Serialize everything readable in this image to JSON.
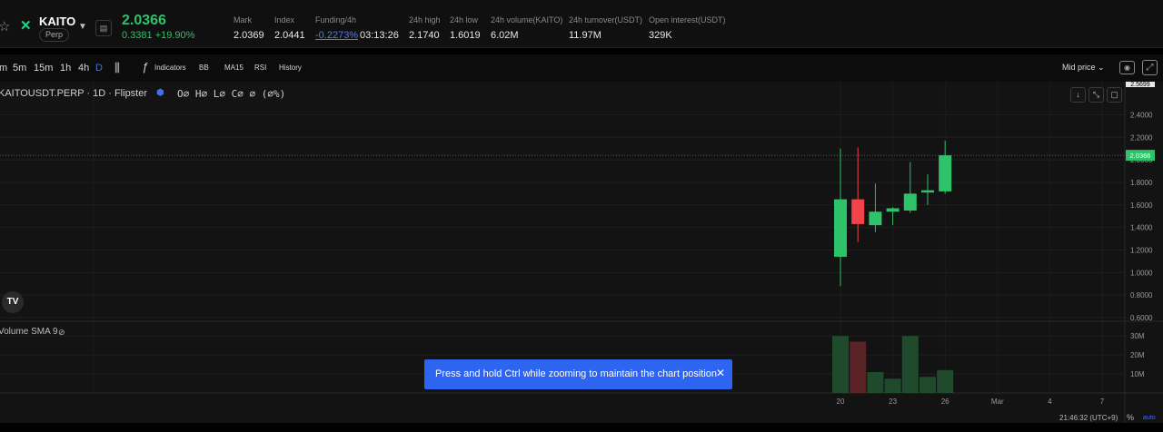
{
  "ticker": {
    "symbol": "KAITO",
    "contract_type": "Perp",
    "last_price": "2.0366",
    "change": "0.3381 +19.90%",
    "price_color": "#2ec26a"
  },
  "stats": [
    {
      "label": "Mark",
      "value": "2.0369"
    },
    {
      "label": "Index",
      "value": "2.0441"
    },
    {
      "label": "Funding/4h",
      "value": "-0.2273%",
      "extra": "03:13:26"
    },
    {
      "label": "24h high",
      "value": "2.1740"
    },
    {
      "label": "24h low",
      "value": "1.6019"
    },
    {
      "label": "24h volume(KAITO)",
      "value": "6.02M"
    },
    {
      "label": "24h turnover(USDT)",
      "value": "11.97M"
    },
    {
      "label": "Open interest(USDT)",
      "value": "329K"
    }
  ],
  "toolbar": {
    "timeframes": [
      "m",
      "5m",
      "15m",
      "1h",
      "4h",
      "D"
    ],
    "active_timeframe": "D",
    "indicators_label": "Indicators",
    "bb_label": "BB",
    "ma_label": "MA15",
    "rsi_label": "RSI",
    "history_label": "History",
    "price_source": "Mid price",
    "icons": [
      "candle-type-icon",
      "fx-icon",
      "camera-icon",
      "expand-icon"
    ]
  },
  "chart": {
    "title": "KAITOUSDT.PERP · 1D · Flipster",
    "ohlc_text": "O∅ H∅ L∅ C∅ ∅ (∅%)",
    "volume_label": "Volume SMA 9",
    "current_price_tag": "2.0366",
    "top_tag": "2.5699",
    "up_color": "#2ec26a",
    "down_color": "#f2424b"
  },
  "chart_data": {
    "type": "candlestick",
    "x_ticks": [
      "20",
      "23",
      "26",
      "Mar",
      "4",
      "7"
    ],
    "y_ticks": [
      "2.4000",
      "2.2000",
      "2.0000",
      "1.8000",
      "1.6000",
      "1.4000",
      "1.2000",
      "1.0000",
      "0.8000",
      "0.6000"
    ],
    "ylim": [
      0.6,
      2.5
    ],
    "candles": [
      {
        "o": 1.14,
        "h": 2.1,
        "l": 0.88,
        "c": 1.65
      },
      {
        "o": 1.65,
        "h": 2.11,
        "l": 1.27,
        "c": 1.43
      },
      {
        "o": 1.42,
        "h": 1.79,
        "l": 1.36,
        "c": 1.54
      },
      {
        "o": 1.54,
        "h": 1.58,
        "l": 1.42,
        "c": 1.57
      },
      {
        "o": 1.55,
        "h": 1.98,
        "l": 1.53,
        "c": 1.7
      },
      {
        "o": 1.71,
        "h": 1.87,
        "l": 1.6,
        "c": 1.73
      },
      {
        "o": 1.72,
        "h": 2.17,
        "l": 1.7,
        "c": 2.04
      }
    ],
    "volume_ticks": [
      "30M",
      "20M",
      "10M"
    ],
    "volume_max": 32,
    "volumes": [
      30,
      27,
      11,
      7.5,
      30,
      8.5,
      12
    ]
  },
  "toast": {
    "text": "Press and hold Ctrl while zooming to maintain the chart position"
  },
  "footer": {
    "clock": "21:46:32 (UTC+9)",
    "percent": "%",
    "auto": "auto"
  }
}
